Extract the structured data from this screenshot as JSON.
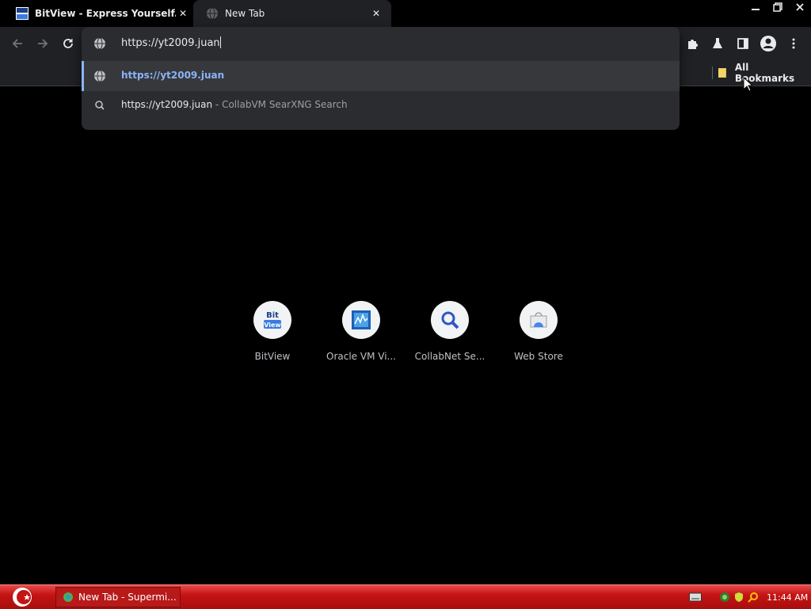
{
  "tabs": [
    {
      "title": "BitView - Express Yourself.",
      "active": false
    },
    {
      "title": "New Tab",
      "active": true
    }
  ],
  "window_controls": [
    "minimize",
    "restore",
    "close"
  ],
  "toolbar": {
    "buttons": [
      "back-icon",
      "forward-icon",
      "reload-icon",
      "extensions-icon",
      "labs-icon",
      "side-panel-icon",
      "profile-icon",
      "menu-icon"
    ]
  },
  "omnibox": {
    "value": "https://yt2009.juan",
    "suggestions": [
      {
        "text": "https://yt2009.juan",
        "icon": "globe-icon",
        "selected": true
      },
      {
        "text": "https://yt2009.juan",
        "separator": "-",
        "description": "CollabVM SearXNG Search",
        "icon": "search-icon",
        "selected": false
      }
    ]
  },
  "bookmarks_bar": {
    "all_bookmarks_label": "All Bookmarks"
  },
  "shortcuts": [
    {
      "label": "BitView",
      "icon": "bitview-icon"
    },
    {
      "label": "Oracle VM Vi...",
      "icon": "virtualbox-icon"
    },
    {
      "label": "CollabNet Se...",
      "icon": "magnifier-icon"
    },
    {
      "label": "Web Store",
      "icon": "webstore-icon"
    }
  ],
  "taskbar": {
    "task_label": "New Tab - Supermi...",
    "clock": "11:44 AM"
  },
  "colors": {
    "accent": "#8ab4f8",
    "taskbar": "#c41414",
    "toolbar": "#202124"
  }
}
